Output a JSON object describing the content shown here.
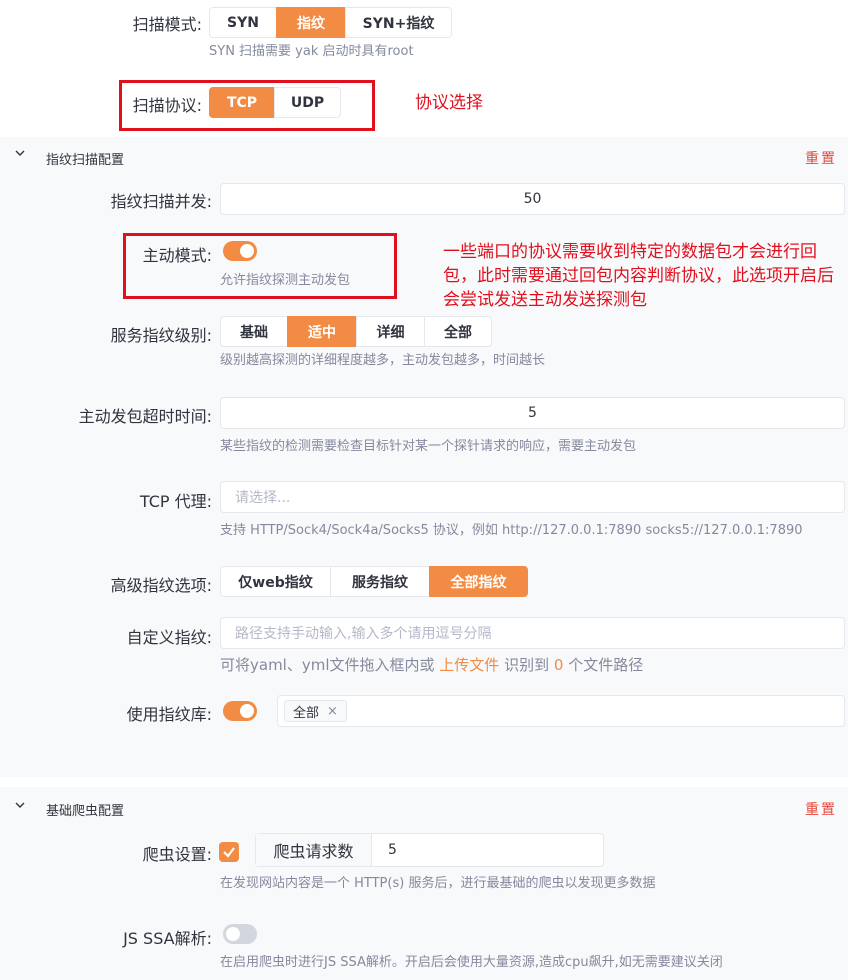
{
  "scan_mode": {
    "label": "扫描模式:",
    "options": [
      "SYN",
      "指纹",
      "SYN+指纹"
    ],
    "active_index": 1,
    "hint": "SYN 扫描需要 yak 启动时具有root"
  },
  "scan_protocol": {
    "label": "扫描协议:",
    "options": [
      "TCP",
      "UDP"
    ],
    "active_index": 0,
    "annotation": "协议选择"
  },
  "fingerprint_section": {
    "title": "指纹扫描配置",
    "reset_label": "重置",
    "concurrency": {
      "label": "指纹扫描并发:",
      "value": "50"
    },
    "active_mode": {
      "label": "主动模式:",
      "enabled": true,
      "hint": "允许指纹探测主动发包",
      "annotation": "一些端口的协议需要收到特定的数据包才会进行回包，此时需要通过回包内容判断协议，此选项开启后会尝试发送主动发送探测包"
    },
    "service_level": {
      "label": "服务指纹级别:",
      "options": [
        "基础",
        "适中",
        "详细",
        "全部"
      ],
      "active_index": 1,
      "hint": "级别越高探测的详细程度越多，主动发包越多，时间越长"
    },
    "probe_timeout": {
      "label": "主动发包超时时间:",
      "value": "5",
      "hint": "某些指纹的检测需要检查目标针对某一个探针请求的响应，需要主动发包"
    },
    "tcp_proxy": {
      "label": "TCP 代理:",
      "placeholder": "请选择...",
      "hint": "支持 HTTP/Sock4/Sock4a/Socks5 协议，例如 http://127.0.0.1:7890 socks5://127.0.0.1:7890"
    },
    "advanced_options": {
      "label": "高级指纹选项:",
      "options": [
        "仅web指纹",
        "服务指纹",
        "全部指纹"
      ],
      "active_index": 2
    },
    "custom_fingerprint": {
      "label": "自定义指纹:",
      "placeholder": "路径支持手动输入,输入多个请用逗号分隔",
      "hint_prefix": "可将yaml、yml文件拖入框内或",
      "upload_link": "上传文件",
      "hint_middle": "识别到",
      "count": "0",
      "hint_suffix": "个文件路径"
    },
    "use_library": {
      "label": "使用指纹库:",
      "enabled": true,
      "tag": "全部",
      "tag_close": "×"
    }
  },
  "crawler_section": {
    "title": "基础爬虫配置",
    "reset_label": "重置",
    "crawler_settings": {
      "label": "爬虫设置:",
      "checked": true,
      "request_label": "爬虫请求数",
      "request_value": "5",
      "hint": "在发现网站内容是一个 HTTP(s) 服务后，进行最基础的爬虫以发现更多数据"
    },
    "js_ssa": {
      "label": "JS SSA解析:",
      "enabled": false,
      "hint": "在启用爬虫时进行JS SSA解析。开启后会使用大量资源,造成cpu飙升,如无需要建议关闭"
    }
  },
  "colors": {
    "accent": "#f28b44",
    "annotation_red": "#e0101f",
    "reset_red": "#e4483c"
  }
}
